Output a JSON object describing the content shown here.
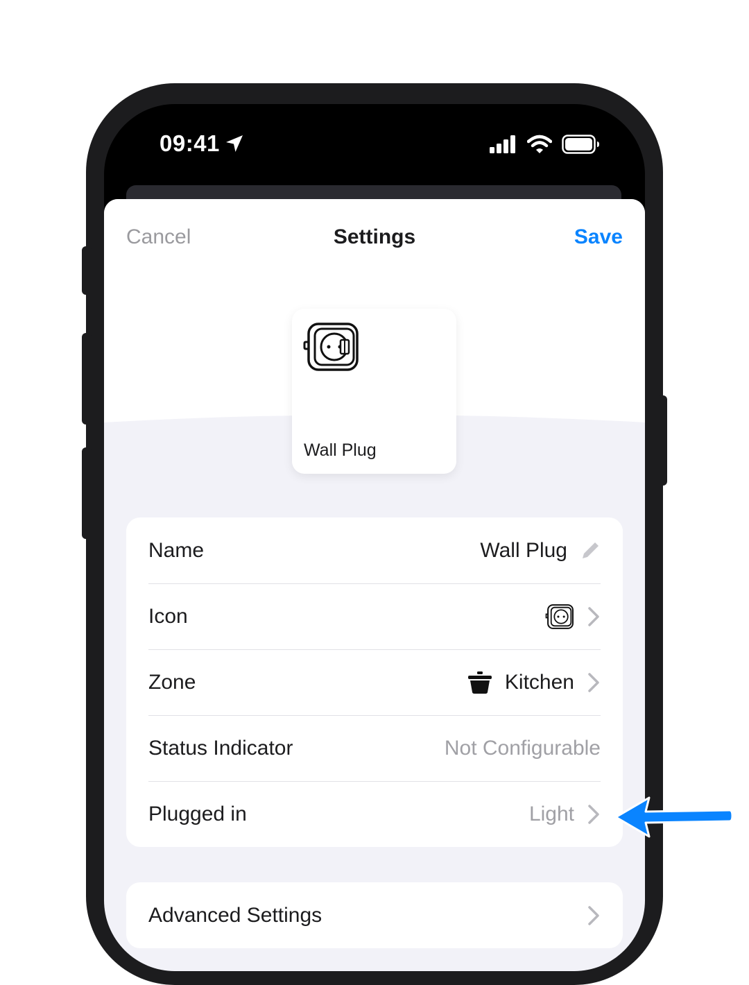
{
  "status_bar": {
    "time": "09:41",
    "location_icon": "location-arrow-icon",
    "signal_icon": "cellular-signal-icon",
    "wifi_icon": "wifi-icon",
    "battery_icon": "battery-icon"
  },
  "nav": {
    "cancel_label": "Cancel",
    "title": "Settings",
    "save_label": "Save"
  },
  "device_card": {
    "icon": "wall-plug-icon",
    "label": "Wall Plug"
  },
  "settings": {
    "rows": [
      {
        "label": "Name",
        "value": "Wall Plug",
        "accessory": "pencil-icon"
      },
      {
        "label": "Icon",
        "value_icon": "wall-plug-icon",
        "accessory": "chevron-right-icon"
      },
      {
        "label": "Zone",
        "value": "Kitchen",
        "value_icon": "pot-icon",
        "accessory": "chevron-right-icon"
      },
      {
        "label": "Status Indicator",
        "value": "Not Configurable"
      },
      {
        "label": "Plugged in",
        "value": "Light",
        "accessory": "chevron-right-icon"
      }
    ]
  },
  "advanced": {
    "label": "Advanced Settings",
    "accessory": "chevron-right-icon"
  },
  "colors": {
    "accent": "#0a84ff",
    "muted_text": "#a0a0a5",
    "sheet_background": "#f2f2f8",
    "arrow": "#0a84ff"
  },
  "annotation": {
    "icon": "arrow-left-icon"
  }
}
